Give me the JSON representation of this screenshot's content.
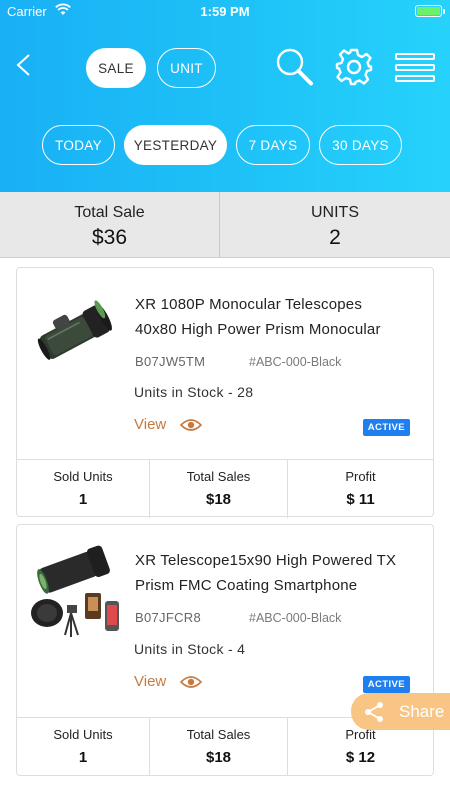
{
  "status_bar": {
    "carrier": "Carrier",
    "time": "1:59 PM"
  },
  "header": {
    "tabs": [
      {
        "label": "SALE",
        "active": true
      },
      {
        "label": "UNIT",
        "active": false
      }
    ],
    "ranges": [
      {
        "label": "TODAY",
        "active": false
      },
      {
        "label": "YESTERDAY",
        "active": true
      },
      {
        "label": "7 DAYS",
        "active": false
      },
      {
        "label": "30 DAYS",
        "active": false
      }
    ],
    "icons": [
      "back-chevron-icon",
      "search-icon",
      "gear-icon",
      "menu-icon"
    ],
    "gradient_colors": [
      "#19b0f5",
      "#26d2fb"
    ]
  },
  "summary": {
    "total_sale_label": "Total Sale",
    "total_sale_value": "$36",
    "units_label": "UNITS",
    "units_value": "2"
  },
  "products": [
    {
      "title_line1": "XR 1080P Monocular Telescopes",
      "title_line2": "40x80 High Power Prism Monocular",
      "sku": "B07JW5TM",
      "variant": "#ABC-000-Black",
      "stock": "Units in Stock - 28",
      "view_label": "View",
      "status": "ACTIVE",
      "sold_units_label": "Sold Units",
      "sold_units": "1",
      "total_sales_label": "Total Sales",
      "total_sales": "$18",
      "profit_label": "Profit",
      "profit": "$ 11"
    },
    {
      "title_line1": "XR Telescope15x90 High Powered TX",
      "title_line2": "Prism FMC Coating Smartphone",
      "sku": "B07JFCR8",
      "variant": "#ABC-000-Black",
      "stock": "Units in Stock - 4",
      "view_label": "View",
      "status": "ACTIVE",
      "sold_units_label": "Sold Units",
      "sold_units": "1",
      "total_sales_label": "Total Sales",
      "total_sales": "$18",
      "profit_label": "Profit",
      "profit": "$ 12"
    }
  ],
  "share": {
    "label": "Share",
    "color": "#f8c27e"
  },
  "colors": {
    "accent": "#1e7ff0",
    "view_link": "#c8793c"
  }
}
